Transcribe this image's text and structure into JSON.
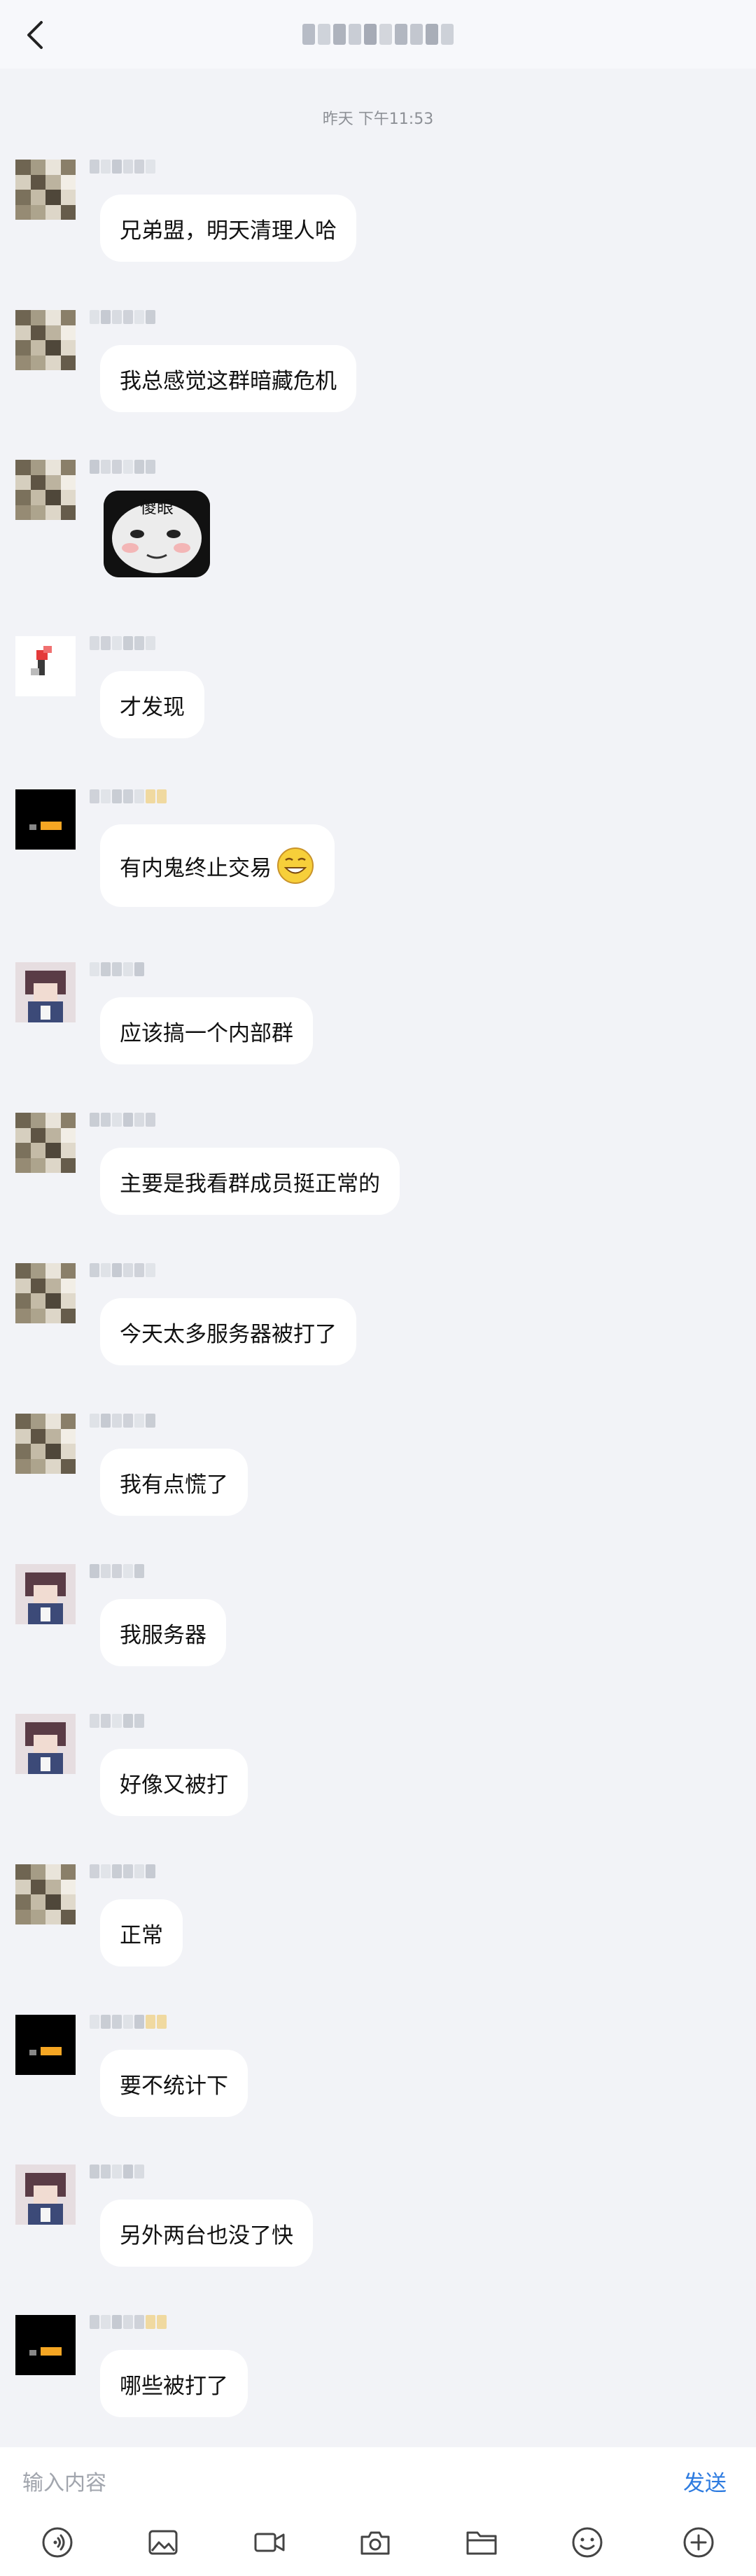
{
  "header": {
    "title": ""
  },
  "chat": {
    "timestamp": "昨天 下午11:53",
    "messages": [
      {
        "sender": "user-a",
        "text": "兄弟盟，明天清理人哈"
      },
      {
        "sender": "user-a",
        "text": "我总感觉这群暗藏危机"
      },
      {
        "sender": "user-a",
        "sticker": "doge-face-sticker",
        "sticker_text": "傻眼"
      },
      {
        "sender": "user-b",
        "text": "才发现"
      },
      {
        "sender": "user-c",
        "text": "有内鬼终止交易",
        "emoji": "grin-emoji"
      },
      {
        "sender": "user-d",
        "text": "应该搞一个内部群"
      },
      {
        "sender": "user-a",
        "text": "主要是我看群成员挺正常的"
      },
      {
        "sender": "user-a",
        "text": "今天太多服务器被打了"
      },
      {
        "sender": "user-a",
        "text": "我有点慌了"
      },
      {
        "sender": "user-d",
        "text": "我服务器"
      },
      {
        "sender": "user-d",
        "text": "好像又被打"
      },
      {
        "sender": "user-a",
        "text": "正常"
      },
      {
        "sender": "user-c",
        "text": "要不统计下"
      },
      {
        "sender": "user-d",
        "text": "另外两台也没了快"
      },
      {
        "sender": "user-c",
        "text": "哪些被打了"
      }
    ]
  },
  "input": {
    "placeholder": "输入内容",
    "send_label": "发送"
  },
  "toolbar": {
    "icons": [
      "voice-icon",
      "image-icon",
      "video-icon",
      "camera-icon",
      "folder-icon",
      "emoji-icon",
      "plus-icon"
    ]
  },
  "colors": {
    "background": "#f2f3f7",
    "bubble": "#ffffff",
    "accent": "#2d7be0"
  }
}
